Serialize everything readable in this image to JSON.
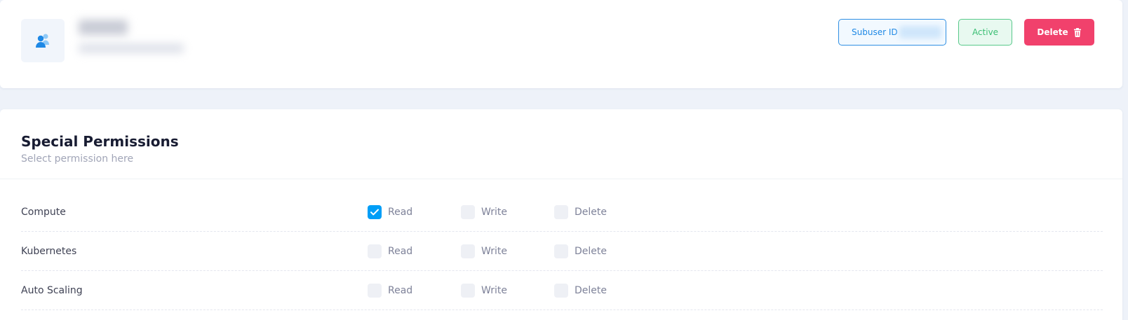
{
  "header": {
    "subuser_label": "Subuser ID",
    "status_label": "Active",
    "delete_label": "Delete"
  },
  "permissions": {
    "title": "Special Permissions",
    "subtitle": "Select permission here",
    "rows": [
      {
        "label": "Compute",
        "options": [
          {
            "label": "Read",
            "checked": true
          },
          {
            "label": "Write",
            "checked": false
          },
          {
            "label": "Delete",
            "checked": false
          }
        ]
      },
      {
        "label": "Kubernetes",
        "options": [
          {
            "label": "Read",
            "checked": false
          },
          {
            "label": "Write",
            "checked": false
          },
          {
            "label": "Delete",
            "checked": false
          }
        ]
      },
      {
        "label": "Auto Scaling",
        "options": [
          {
            "label": "Read",
            "checked": false
          },
          {
            "label": "Write",
            "checked": false
          },
          {
            "label": "Delete",
            "checked": false
          }
        ]
      }
    ]
  },
  "colors": {
    "accent": "#009ef7",
    "danger": "#f1416c",
    "success": "#3bbf74",
    "page_bg": "#eef2f9"
  },
  "icons": {
    "avatar": "users-icon",
    "delete": "trash-icon",
    "check": "check-icon"
  }
}
